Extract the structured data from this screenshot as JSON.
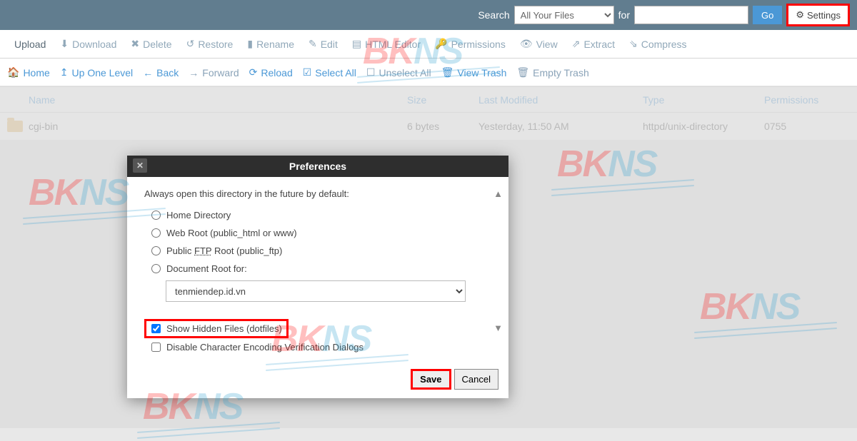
{
  "topbar": {
    "search_label": "Search",
    "location_selected": "All Your Files",
    "for_label": "for",
    "search_value": "",
    "go_label": "Go",
    "settings_label": "Settings"
  },
  "toolbar1": {
    "upload": "Upload",
    "download": "Download",
    "delete": "Delete",
    "restore": "Restore",
    "rename": "Rename",
    "edit": "Edit",
    "html_editor": "HTML Editor",
    "permissions": "Permissions",
    "view": "View",
    "extract": "Extract",
    "compress": "Compress"
  },
  "toolbar2": {
    "home": "Home",
    "up_one": "Up One Level",
    "back": "Back",
    "forward": "Forward",
    "reload": "Reload",
    "select_all": "Select All",
    "unselect_all": "Unselect All",
    "view_trash": "View Trash",
    "empty_trash": "Empty Trash"
  },
  "table": {
    "headers": {
      "name": "Name",
      "size": "Size",
      "modified": "Last Modified",
      "type": "Type",
      "perm": "Permissions"
    },
    "rows": [
      {
        "name": "cgi-bin",
        "size": "6 bytes",
        "modified": "Yesterday, 11:50 AM",
        "type": "httpd/unix-directory",
        "perm": "0755"
      }
    ]
  },
  "modal": {
    "title": "Preferences",
    "prompt": "Always open this directory in the future by default:",
    "opt_home": "Home Directory",
    "opt_webroot": "Web Root (public_html or www)",
    "opt_ftp_a": "Public ",
    "opt_ftp_u": "FTP",
    "opt_ftp_b": " Root (public_ftp)",
    "opt_docroot": "Document Root for:",
    "docroot_value": "tenmiendep.id.vn",
    "chk_hidden": "Show Hidden Files (dotfiles)",
    "chk_encoding": "Disable Character Encoding Verification Dialogs",
    "save": "Save",
    "cancel": "Cancel"
  },
  "watermark": {
    "a": "BK",
    "b": "NS"
  }
}
